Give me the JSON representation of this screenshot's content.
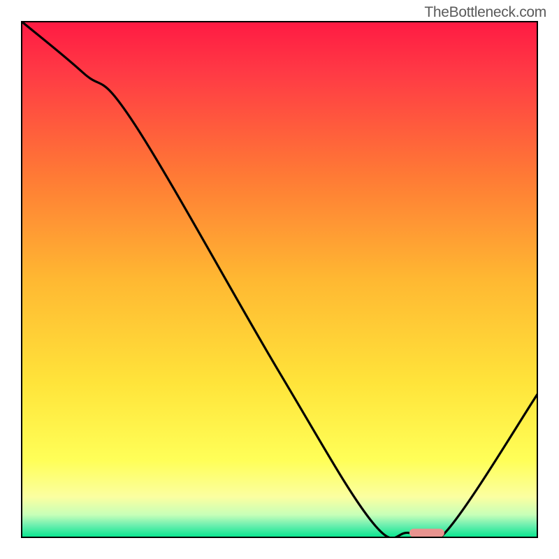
{
  "watermark": "TheBottleneck.com",
  "chart_data": {
    "type": "line",
    "title": "",
    "xlabel": "",
    "ylabel": "",
    "xlim": [
      0,
      100
    ],
    "ylim": [
      0,
      100
    ],
    "series": [
      {
        "name": "bottleneck-curve",
        "x": [
          0,
          12,
          22,
          50,
          68,
          75,
          82,
          100
        ],
        "y": [
          100,
          90,
          80,
          32,
          3,
          1,
          1,
          28
        ],
        "color": "#000000"
      }
    ],
    "marker": {
      "name": "optimal-point",
      "x": 78.5,
      "y": 1,
      "color": "#e8938f"
    },
    "background_gradient": {
      "stops": [
        {
          "pos": 0.0,
          "color": "#ff1a43"
        },
        {
          "pos": 0.1,
          "color": "#ff3a45"
        },
        {
          "pos": 0.3,
          "color": "#ff7a35"
        },
        {
          "pos": 0.5,
          "color": "#ffb832"
        },
        {
          "pos": 0.7,
          "color": "#ffe43a"
        },
        {
          "pos": 0.85,
          "color": "#ffff58"
        },
        {
          "pos": 0.92,
          "color": "#fbffa0"
        },
        {
          "pos": 0.955,
          "color": "#c8ffb8"
        },
        {
          "pos": 0.975,
          "color": "#6eefb0"
        },
        {
          "pos": 1.0,
          "color": "#00e58c"
        }
      ]
    }
  }
}
